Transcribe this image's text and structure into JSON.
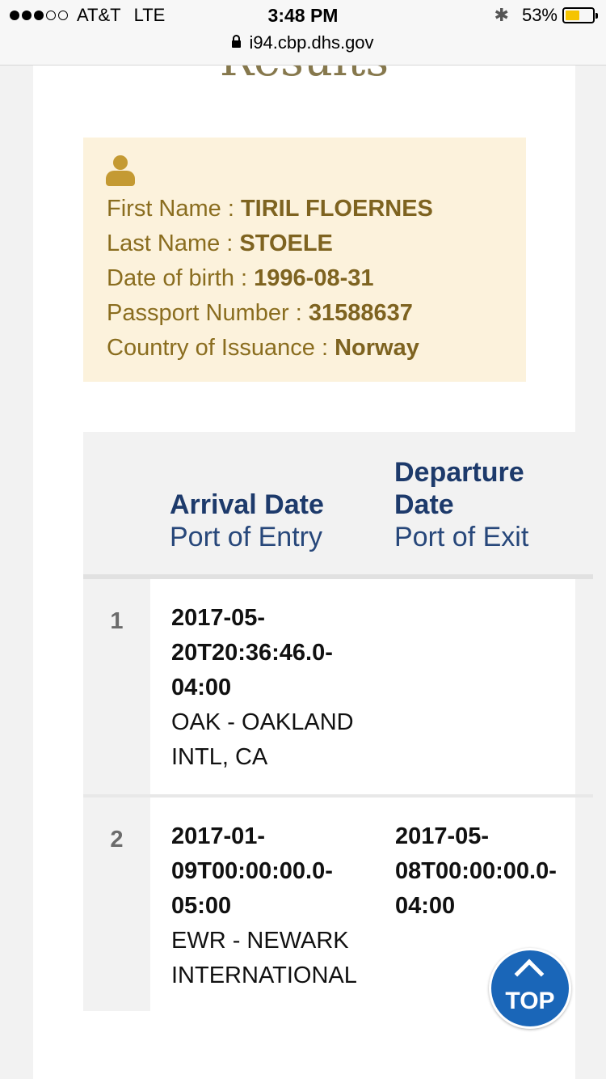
{
  "status_bar": {
    "carrier": "AT&T",
    "network": "LTE",
    "time": "3:48 PM",
    "url": "i94.cbp.dhs.gov",
    "battery": "53%",
    "battery_level": 0.53,
    "signal_bars_filled": 3,
    "signal_bars_total": 5
  },
  "page": {
    "title": "Results"
  },
  "person": {
    "icon": "user-icon",
    "rows": [
      {
        "label": "First Name : ",
        "value": "TIRIL FLOERNES"
      },
      {
        "label": "Last Name : ",
        "value": "STOELE"
      },
      {
        "label": "Date of birth : ",
        "value": "1996-08-31"
      },
      {
        "label": "Passport Number : ",
        "value": "31588637"
      },
      {
        "label": "Country of Issuance : ",
        "value": "Norway"
      }
    ]
  },
  "table": {
    "headers": {
      "arrival": {
        "title": "Arrival Date",
        "subtitle": "Port of Entry"
      },
      "departure": {
        "title": "Departure Date",
        "subtitle": "Port of Exit"
      }
    },
    "rows": [
      {
        "index": "1",
        "arrival_date": [
          "2017-05-",
          "20T20:36:46.0-",
          "04:00"
        ],
        "arrival_port": [
          "OAK - OAKLAND",
          "INTL, CA"
        ],
        "departure_date": [],
        "departure_port": []
      },
      {
        "index": "2",
        "arrival_date": [
          "2017-01-",
          "09T00:00:00.0-",
          "05:00"
        ],
        "arrival_port": [
          "EWR - NEWARK",
          "INTERNATIONAL"
        ],
        "departure_date": [
          "2017-05-",
          "08T00:00:00.0-",
          "04:00"
        ],
        "departure_port": []
      }
    ]
  },
  "top_button": {
    "label": "TOP",
    "icon": "chevron-up-icon"
  }
}
